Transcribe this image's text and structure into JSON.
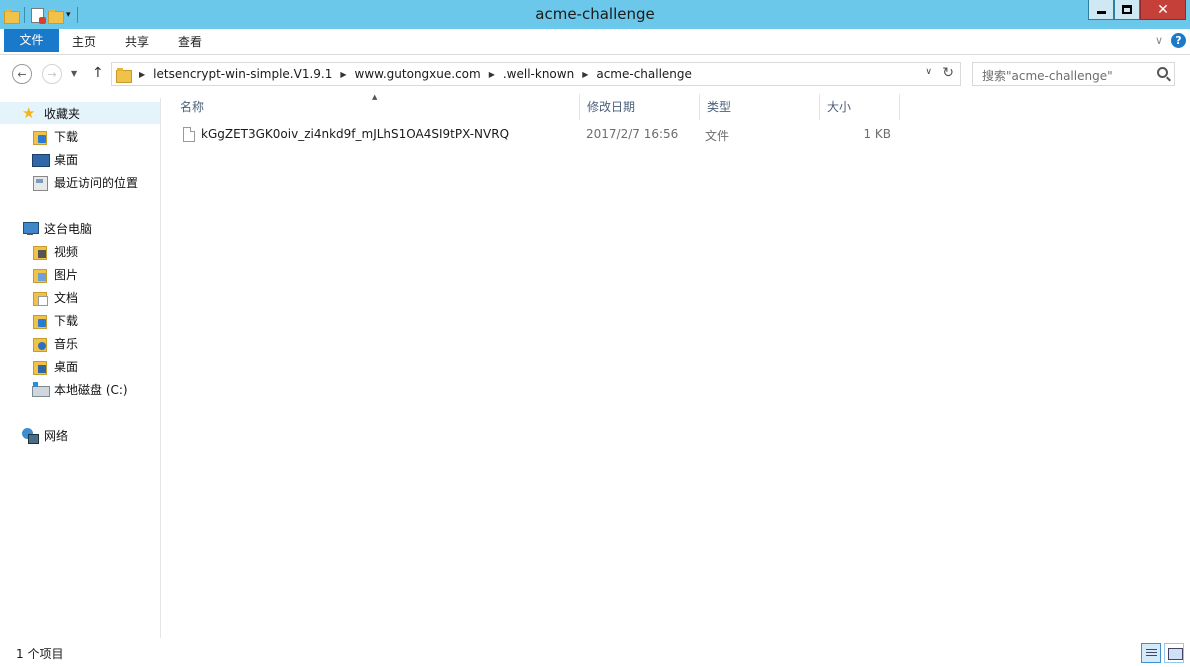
{
  "window": {
    "title": "acme-challenge",
    "minimize_label": "",
    "maximize_label": "",
    "close_label": "✕"
  },
  "ribbon": {
    "tabs": [
      "文件",
      "主页",
      "共享",
      "查看"
    ],
    "expand_icon": "chevron-down-icon",
    "help_label": "?"
  },
  "address": {
    "breadcrumbs": [
      "letsencrypt-win-simple.V1.9.1",
      "www.gutongxue.com",
      ".well-known",
      "acme-challenge"
    ]
  },
  "search": {
    "placeholder": "搜索\"acme-challenge\""
  },
  "nav_pane": {
    "favorites": {
      "label": "收藏夹",
      "items": [
        "下载",
        "桌面",
        "最近访问的位置"
      ]
    },
    "this_pc": {
      "label": "这台电脑",
      "items": [
        "视频",
        "图片",
        "文档",
        "下载",
        "音乐",
        "桌面",
        "本地磁盘 (C:)"
      ]
    },
    "network": {
      "label": "网络"
    }
  },
  "columns": {
    "name": "名称",
    "modified": "修改日期",
    "type": "类型",
    "size": "大小"
  },
  "files": [
    {
      "name": "kGgZET3GK0oiv_zi4nkd9f_mJLhS1OA4SI9tPX-NVRQ",
      "modified": "2017/2/7 16:56",
      "type": "文件",
      "size": "1 KB"
    }
  ],
  "status": {
    "item_count": "1 个项目"
  },
  "colors": {
    "titlebar": "#6bc8ea",
    "file_tab": "#1979ca",
    "close_button": "#c6403a",
    "selection": "#e5f3fb"
  }
}
